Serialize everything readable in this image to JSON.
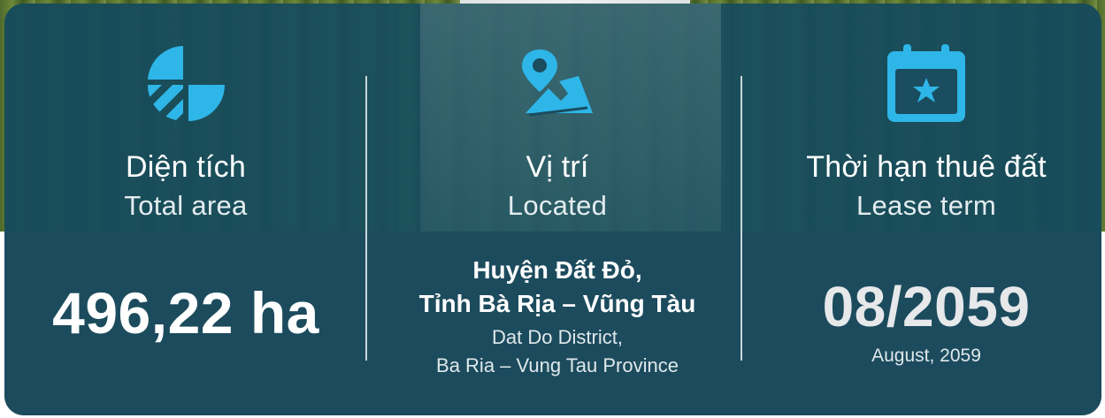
{
  "colors": {
    "card": "#1b4a5c",
    "accent": "#2eb6e8",
    "text": "#ffffff"
  },
  "area": {
    "icon": "pie-chart-icon",
    "label_vi": "Diện tích",
    "label_en": "Total area",
    "value": "496,22 ha"
  },
  "location": {
    "icon": "map-pin-icon",
    "label_vi": "Vị trí",
    "label_en": "Located",
    "line1": "Huyện Đất Đỏ,",
    "line2": "Tỉnh Bà Rịa – Vũng Tàu",
    "sub1": "Dat Do District,",
    "sub2": "Ba Ria – Vung Tau Province"
  },
  "lease": {
    "icon": "calendar-star-icon",
    "label_vi": "Thời hạn thuê đất",
    "label_en": "Lease term",
    "value": "08/2059",
    "sub": "August, 2059"
  }
}
